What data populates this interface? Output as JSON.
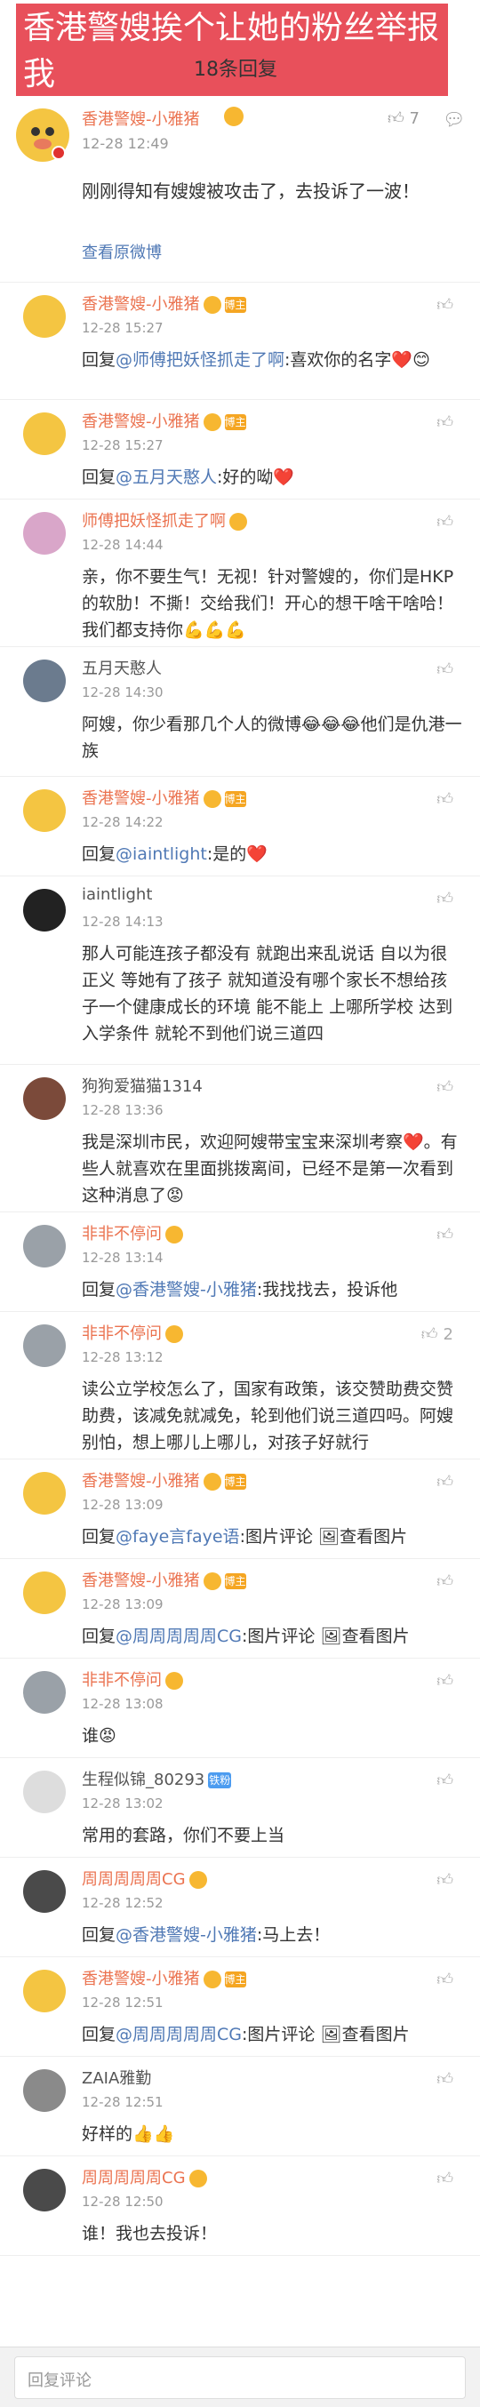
{
  "banner": {
    "title": "香港警嫂挨个让她的粉丝举报我"
  },
  "header": {
    "reply_count": "18条回复"
  },
  "post": {
    "author": "香港警嫂-小雅猪",
    "time": "12-28 12:49",
    "likes": "7",
    "text": "刚刚得知有嫂嫂被攻击了，去投诉了一波！",
    "view_original": "查看原微博"
  },
  "comments": [
    {
      "author": "香港警嫂-小雅猪",
      "time": "12-28 15:27",
      "prefix": "回复",
      "mention": "@师傅把妖怪抓走了啊",
      "text": ":喜欢你的名字❤️😊"
    },
    {
      "author": "香港警嫂-小雅猪",
      "time": "12-28 15:27",
      "prefix": "回复",
      "mention": "@五月天憨人",
      "text": ":好的呦❤️"
    },
    {
      "author": "师傅把妖怪抓走了啊",
      "time": "12-28 14:44",
      "prefix": "",
      "mention": "",
      "text": "亲，你不要生气！无视！针对警嫂的，你们是HKP的软肋！不撕！交给我们！开心的想干啥干啥哈！我们都支持你💪💪💪"
    },
    {
      "author": "五月天憨人",
      "time": "12-28 14:30",
      "prefix": "",
      "mention": "",
      "text": "阿嫂，你少看那几个人的微博😂😂😂他们是仇港一族"
    },
    {
      "author": "香港警嫂-小雅猪",
      "time": "12-28 14:22",
      "prefix": "回复",
      "mention": "@iaintlight",
      "text": ":是的❤️"
    },
    {
      "author": "iaintlight",
      "time": "12-28 14:13",
      "prefix": "",
      "mention": "",
      "text": "那人可能连孩子都没有 就跑出来乱说话 自以为很正义 等她有了孩子 就知道没有哪个家长不想给孩子一个健康成长的环境  能不能上 上哪所学校  达到入学条件 就轮不到他们说三道四"
    },
    {
      "author": "狗狗爱猫猫1314",
      "time": "12-28 13:36",
      "prefix": "",
      "mention": "",
      "text": "我是深圳市民，欢迎阿嫂带宝宝来深圳考察❤️。有些人就喜欢在里面挑拨离间，已经不是第一次看到这种消息了😡"
    },
    {
      "author": "非非不停问",
      "time": "12-28 13:14",
      "prefix": "回复",
      "mention": "@香港警嫂-小雅猪",
      "text": ":我找找去，投诉他"
    },
    {
      "author": "非非不停问",
      "time": "12-28 13:12",
      "prefix": "",
      "mention": "",
      "likes": "2",
      "text": "读公立学校怎么了，国家有政策，该交赞助费交赞助费，该减免就减免，轮到他们说三道四吗。阿嫂别怕，想上哪儿上哪儿，对孩子好就行"
    },
    {
      "author": "香港警嫂-小雅猪",
      "time": "12-28 13:09",
      "prefix": "回复",
      "mention": "@faye言faye语",
      "text": ":图片评论 🖼查看图片"
    },
    {
      "author": "香港警嫂-小雅猪",
      "time": "12-28 13:09",
      "prefix": "回复",
      "mention": "@周周周周周CG",
      "text": ":图片评论 🖼查看图片"
    },
    {
      "author": "非非不停问",
      "time": "12-28 13:08",
      "prefix": "",
      "mention": "",
      "text": "谁😡"
    },
    {
      "author": "生程似锦_80293",
      "time": "12-28 13:02",
      "prefix": "",
      "mention": "",
      "text": "常用的套路，你们不要上当"
    },
    {
      "author": "周周周周周CG",
      "time": "12-28 12:52",
      "prefix": "回复",
      "mention": "@香港警嫂-小雅猪",
      "text": ":马上去！"
    },
    {
      "author": "香港警嫂-小雅猪",
      "time": "12-28 12:51",
      "prefix": "回复",
      "mention": "@周周周周周CG",
      "text": ":图片评论 🖼查看图片"
    },
    {
      "author": "ZAIA雅勤",
      "time": "12-28 12:51",
      "prefix": "",
      "mention": "",
      "text": "好样的👍👍"
    },
    {
      "author": "周周周周周CG",
      "time": "12-28 12:50",
      "prefix": "",
      "mention": "",
      "text": "谁！我也去投诉！"
    }
  ],
  "badges": {
    "cert": "博主",
    "fans": "铁粉"
  },
  "reply_bar": {
    "placeholder": "回复评论"
  },
  "colors": {
    "accent": "#eb7350",
    "link": "#5079b5",
    "banner": "#e8505b"
  }
}
